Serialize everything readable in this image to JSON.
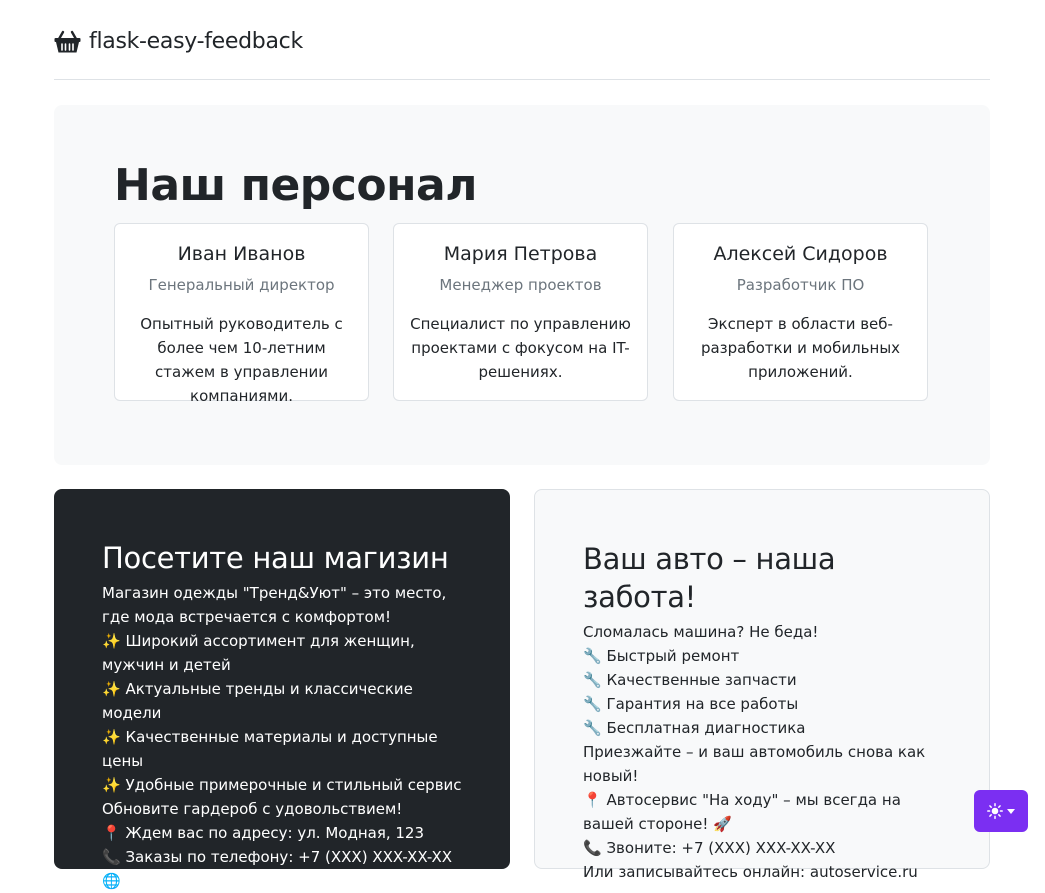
{
  "header": {
    "brand": "flask-easy-feedback",
    "brand_icon": "basket-icon"
  },
  "team": {
    "title": "Наш персонал",
    "members": [
      {
        "name": "Иван Иванов",
        "role": "Генеральный директор",
        "bio": "Опытный руководитель с более чем 10-летним стажем в управлении компаниями."
      },
      {
        "name": "Мария Петрова",
        "role": "Менеджер проектов",
        "bio": "Специалист по управлению проектами с фокусом на IT-решениях."
      },
      {
        "name": "Алексей Сидоров",
        "role": "Разработчик ПО",
        "bio": "Эксперт в области веб-разработки и мобильных приложений."
      }
    ]
  },
  "shop": {
    "title": "Посетите наш магизин",
    "lines": [
      "Магазин одежды \"Тренд&Уют\" – это место, где мода встречается с комфортом!",
      "✨ Широкий ассортимент для женщин, мужчин и детей",
      "✨ Актуальные тренды и классические модели",
      "✨ Качественные материалы и доступные цены",
      "✨ Удобные примерочные и стильный сервис",
      "Обновите гардероб с удовольствием!",
      "📍 Ждем вас по адресу: ул. Модная, 123",
      "📞 Заказы по телефону: +7 (XXX) XXX-XX-XX",
      "🌐 Онлайн-шопинг: trend-uyut.ru"
    ]
  },
  "auto": {
    "title": "Ваш авто – наша забота!",
    "lines": [
      "Сломалась машина? Не беда!",
      "🔧 Быстрый ремонт",
      "🔧 Качественные запчасти",
      "🔧 Гарантия на все работы",
      "🔧 Бесплатная диагностика",
      "Приезжайте – и ваш автомобиль снова как новый!",
      "📍 Автосервис \"На ходу\" – мы всегда на вашей стороне! 🚀",
      "📞 Звоните: +7 (XXX) XXX-XX-XX",
      "Или записывайтесь онлайн: autoservice.ru"
    ]
  },
  "theme_toggle": {
    "icon": "sun-icon",
    "color": "#7b2ff2"
  }
}
